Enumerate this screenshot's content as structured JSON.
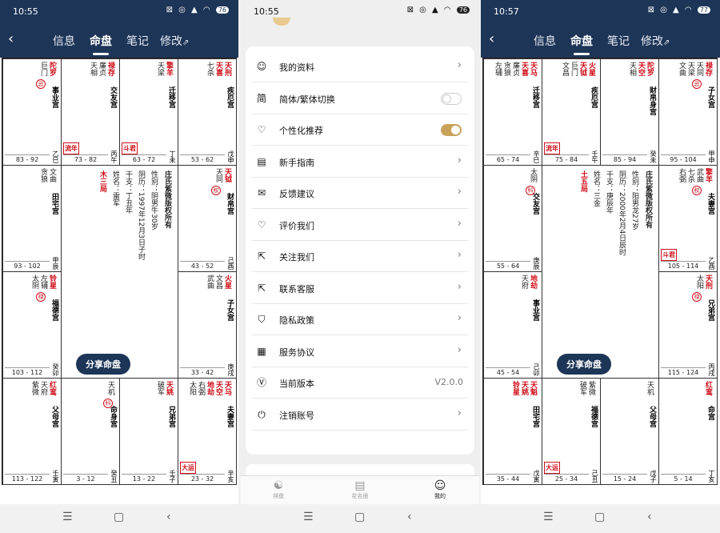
{
  "s1": {
    "time": "10:55",
    "status_icons": "⊠ ◎ ▲ ◠",
    "battery": "76",
    "tabs": [
      "信息",
      "命盘",
      "笔记",
      "修改"
    ],
    "cells": [
      {
        "stars": [
          "巨门"
        ],
        "reds": [
          "陀罗"
        ],
        "hua": "忌",
        "palace": "事业宫",
        "gz": "乙巳",
        "range": "83 - 92",
        "tag": ""
      },
      {
        "stars": [
          "天相",
          "廉贞"
        ],
        "reds": [
          "禄存"
        ],
        "hua": "",
        "palace": "交友宫",
        "gz": "丙午",
        "range": "73 - 82",
        "tag": "流年"
      },
      {
        "stars": [
          "天梁"
        ],
        "reds": [
          "擎羊"
        ],
        "hua": "",
        "palace": "迁移宫",
        "gz": "丁未",
        "range": "63 - 72",
        "tag": "斗君"
      },
      {
        "stars": [
          "七杀"
        ],
        "reds": [
          "天刑",
          "天喜"
        ],
        "hua": "",
        "palace": "疾厄宫",
        "gz": "戊申",
        "range": "53 - 62",
        "tag": ""
      },
      {
        "stars": [
          "贪狼",
          "文曲"
        ],
        "reds": [],
        "hua": "",
        "palace": "田宅宫",
        "gz": "甲辰",
        "range": "93 - 102",
        "tag": ""
      },
      {
        "stars": [
          "天同"
        ],
        "reds": [
          "天钺"
        ],
        "hua": "权",
        "palace": "财帛宫",
        "gz": "己酉",
        "range": "43 - 52",
        "tag": ""
      },
      {
        "stars": [
          "太阴",
          "左辅"
        ],
        "reds": [
          "铃星"
        ],
        "hua": "禄",
        "palace": "福德宫",
        "gz": "癸卯",
        "range": "103 - 112",
        "tag": ""
      },
      {
        "stars": [
          "武曲",
          "文昌"
        ],
        "reds": [
          "火星"
        ],
        "hua": "",
        "palace": "子女宫",
        "gz": "庚戌",
        "range": "33 - 42",
        "tag": ""
      },
      {
        "stars": [
          "紫微",
          "天府"
        ],
        "reds": [
          "红鸾"
        ],
        "hua": "",
        "palace": "父母宫",
        "gz": "壬寅",
        "range": "113 - 122",
        "tag": ""
      },
      {
        "stars": [
          "天机"
        ],
        "reds": [],
        "hua": "科",
        "palace": "命身宫",
        "gz": "癸丑",
        "range": "3 - 12",
        "tag": ""
      },
      {
        "stars": [
          "破军"
        ],
        "reds": [
          "天姚"
        ],
        "hua": "",
        "palace": "兄弟宫",
        "gz": "壬子",
        "range": "13 - 22",
        "tag": ""
      },
      {
        "stars": [
          "太阳",
          "右弼"
        ],
        "reds": [
          "天马",
          "天空",
          "地劫"
        ],
        "hua": "",
        "palace": "夫妻宫",
        "gz": "辛亥",
        "range": "23 - 32",
        "tag": "大运"
      }
    ],
    "center": {
      "ju": "木三局",
      "cols": [
        "姓名：雷军",
        "干支：丁丑年",
        "阴历：1997年12月3日子时",
        "性别：阴男牛30岁",
        "庄氏紫微版权所有"
      ]
    },
    "share": "分享命盘"
  },
  "s2": {
    "time": "10:55",
    "battery": "76",
    "items": [
      {
        "icon": "user-icon",
        "glyph": "☺",
        "label": "我的资料",
        "kind": "chev"
      },
      {
        "icon": "simplified-icon",
        "glyph": "简",
        "label": "简体/繁体切换",
        "kind": "toggle-off"
      },
      {
        "icon": "heart-gear-icon",
        "glyph": "♡",
        "label": "个性化推荐",
        "kind": "toggle-on"
      },
      {
        "icon": "book-icon",
        "glyph": "▤",
        "label": "新手指南",
        "kind": "chev"
      },
      {
        "icon": "mail-icon",
        "glyph": "✉",
        "label": "反馈建议",
        "kind": "chev"
      },
      {
        "icon": "rate-icon",
        "glyph": "♡",
        "label": "评价我们",
        "kind": "chev"
      },
      {
        "icon": "share-icon",
        "glyph": "⇱",
        "label": "关注我们",
        "kind": "chev"
      },
      {
        "icon": "contact-icon",
        "glyph": "⇱",
        "label": "联系客服",
        "kind": "chev"
      },
      {
        "icon": "shield-icon",
        "glyph": "⛉",
        "label": "隐私政策",
        "kind": "chev"
      },
      {
        "icon": "doc-icon",
        "glyph": "▦",
        "label": "服务协议",
        "kind": "chev"
      },
      {
        "icon": "version-icon",
        "glyph": "Ⓥ",
        "label": "当前版本",
        "kind": "value",
        "value": "V2.0.0"
      },
      {
        "icon": "power-icon",
        "glyph": "⏻",
        "label": "注销账号",
        "kind": "chev"
      }
    ],
    "tabbar": [
      "排盘",
      "花名册",
      "我的"
    ]
  },
  "s3": {
    "time": "10:57",
    "battery": "77",
    "tabs": [
      "信息",
      "命盘",
      "笔记",
      "修改"
    ],
    "cells": [
      {
        "stars": [
          "左辅",
          "贪狼",
          "廉贞"
        ],
        "reds": [
          "天马",
          "天喜"
        ],
        "hua": "",
        "palace": "迁移宫",
        "gz": "辛巳",
        "range": "65 - 74",
        "tag": ""
      },
      {
        "stars": [
          "文昌",
          "巨门"
        ],
        "reds": [
          "火星",
          "天钺"
        ],
        "hua": "",
        "palace": "疾厄宫",
        "gz": "壬午",
        "range": "75 - 84",
        "tag": "流年"
      },
      {
        "stars": [
          "天相"
        ],
        "reds": [
          "陀罗",
          "天空"
        ],
        "hua": "",
        "palace": "财帛身宫",
        "gz": "癸未",
        "range": "85 - 94",
        "tag": ""
      },
      {
        "stars": [
          "文曲",
          "天梁",
          "天同"
        ],
        "reds": [
          "禄存"
        ],
        "hua": "忌",
        "palace": "子女宫",
        "gz": "甲申",
        "range": "95 - 104",
        "tag": ""
      },
      {
        "stars": [
          "太阴"
        ],
        "reds": [],
        "hua": "科",
        "palace": "交友宫",
        "gz": "庚辰",
        "range": "55 - 64",
        "tag": ""
      },
      {
        "stars": [
          "右弼",
          "七杀",
          "武曲"
        ],
        "reds": [
          "擎羊"
        ],
        "hua": "权",
        "palace": "夫妻宫",
        "gz": "乙酉",
        "range": "105 - 114",
        "tag": "斗君"
      },
      {
        "stars": [
          "天府"
        ],
        "reds": [
          "地劫"
        ],
        "hua": "",
        "palace": "事业宫",
        "gz": "己卯",
        "range": "45 - 54",
        "tag": ""
      },
      {
        "stars": [
          "太阳"
        ],
        "reds": [
          "天刑"
        ],
        "hua": "禄",
        "palace": "兄弟宫",
        "gz": "丙戌",
        "range": "115 - 124",
        "tag": ""
      },
      {
        "stars": [],
        "reds": [
          "天魁",
          "天姚",
          "铃星"
        ],
        "hua": "",
        "palace": "田宅宫",
        "gz": "戊寅",
        "range": "35 - 44",
        "tag": ""
      },
      {
        "stars": [
          "破军",
          "紫微"
        ],
        "reds": [],
        "hua": "",
        "palace": "福德宫",
        "gz": "己丑",
        "range": "25 - 34",
        "tag": "大运"
      },
      {
        "stars": [
          "天机"
        ],
        "reds": [],
        "hua": "",
        "palace": "父母宫",
        "gz": "戊子",
        "range": "15 - 24",
        "tag": ""
      },
      {
        "stars": [],
        "reds": [
          "红鸾"
        ],
        "hua": "",
        "palace": "命宫",
        "gz": "丁亥",
        "range": "5 - 14",
        "tag": ""
      }
    ],
    "center": {
      "ju": "土五局",
      "cols": [
        "姓名：三金",
        "干支：庚辰年",
        "阴历：2000年2月4日辰时",
        "性别：阳男龙27岁",
        "庄氏紫微版权所有"
      ]
    },
    "share": "分享命盘"
  }
}
